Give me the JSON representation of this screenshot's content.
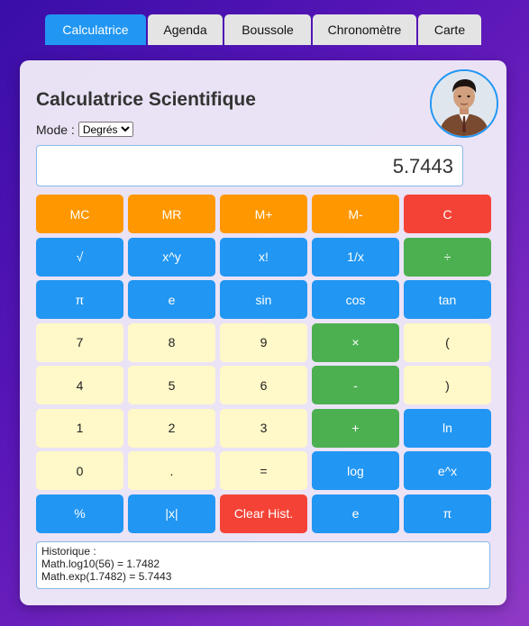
{
  "tabs": [
    "Calculatrice",
    "Agenda",
    "Boussole",
    "Chronomètre",
    "Carte"
  ],
  "active_tab": "Calculatrice",
  "title": "Calculatrice Scientifique",
  "mode": {
    "label": "Mode :",
    "selected": "Degrés"
  },
  "display": {
    "value": "5.7443"
  },
  "buttons": [
    {
      "label": "MC",
      "style": "memory"
    },
    {
      "label": "MR",
      "style": "memory"
    },
    {
      "label": "M+",
      "style": "memory"
    },
    {
      "label": "M-",
      "style": "memory"
    },
    {
      "label": "C",
      "style": "clear"
    },
    {
      "label": "√",
      "style": "func"
    },
    {
      "label": "x^y",
      "style": "func"
    },
    {
      "label": "x!",
      "style": "func"
    },
    {
      "label": "1/x",
      "style": "func"
    },
    {
      "label": "÷",
      "style": "op"
    },
    {
      "label": "π",
      "style": "func"
    },
    {
      "label": "e",
      "style": "func"
    },
    {
      "label": "sin",
      "style": "func"
    },
    {
      "label": "cos",
      "style": "func"
    },
    {
      "label": "tan",
      "style": "func"
    },
    {
      "label": "7",
      "style": "num"
    },
    {
      "label": "8",
      "style": "num"
    },
    {
      "label": "9",
      "style": "num"
    },
    {
      "label": "×",
      "style": "op"
    },
    {
      "label": "(",
      "style": "num"
    },
    {
      "label": "4",
      "style": "num"
    },
    {
      "label": "5",
      "style": "num"
    },
    {
      "label": "6",
      "style": "num"
    },
    {
      "label": "-",
      "style": "op"
    },
    {
      "label": ")",
      "style": "num"
    },
    {
      "label": "1",
      "style": "num"
    },
    {
      "label": "2",
      "style": "num"
    },
    {
      "label": "3",
      "style": "num"
    },
    {
      "label": "+",
      "style": "op"
    },
    {
      "label": "ln",
      "style": "func"
    },
    {
      "label": "0",
      "style": "num"
    },
    {
      "label": ".",
      "style": "num"
    },
    {
      "label": "=",
      "style": "num"
    },
    {
      "label": "log",
      "style": "func"
    },
    {
      "label": "e^x",
      "style": "func"
    },
    {
      "label": "%",
      "style": "func"
    },
    {
      "label": "|x|",
      "style": "func"
    },
    {
      "label": "Clear Hist.",
      "style": "clear"
    },
    {
      "label": "e",
      "style": "func"
    },
    {
      "label": "π",
      "style": "func"
    }
  ],
  "history": {
    "label": "Historique :",
    "entries": [
      "Math.log10(56) = 1.7482",
      "Math.exp(1.7482) = 5.7443"
    ]
  },
  "colors": {
    "memory": "#ff9800",
    "clear": "#f44336",
    "func": "#2196f3",
    "op": "#4caf50",
    "num": "#fff8c8",
    "active_tab": "#2196f3"
  }
}
